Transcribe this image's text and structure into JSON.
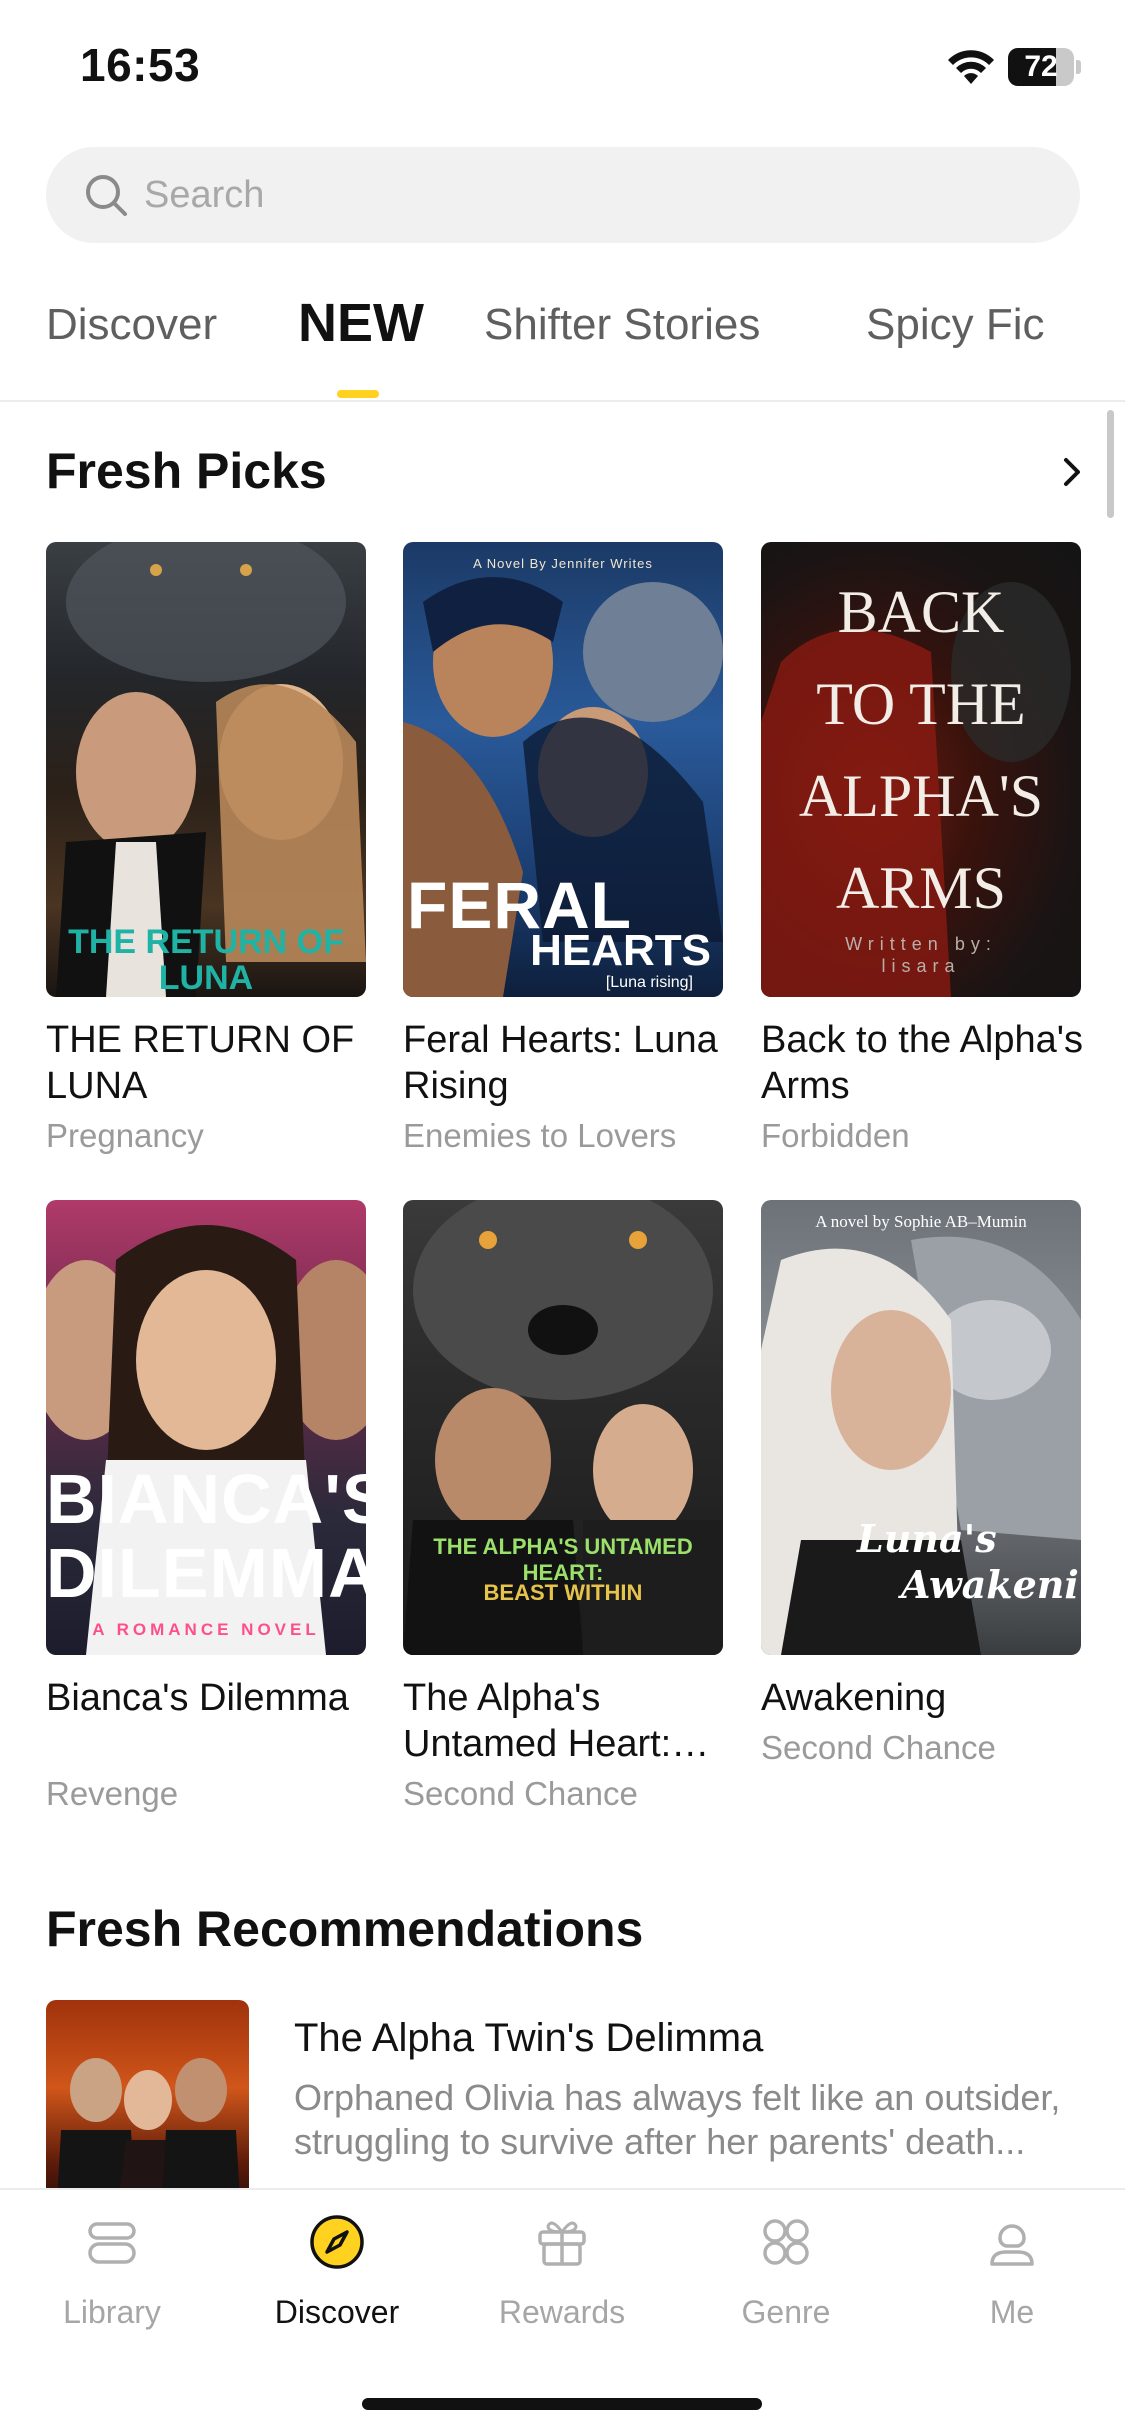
{
  "status": {
    "time": "16:53",
    "battery": "72",
    "battery_level": 0.72
  },
  "search": {
    "placeholder": "Search"
  },
  "tabs": [
    {
      "label": "Discover"
    },
    {
      "label": "NEW"
    },
    {
      "label": "Shifter Stories"
    },
    {
      "label": "Spicy Fic"
    }
  ],
  "fresh_picks": {
    "title": "Fresh Picks",
    "books": [
      {
        "title": "THE RETURN OF LUNA",
        "tag": "Pregnancy",
        "cover_text": "THE RETURN OF LUNA"
      },
      {
        "title": "Feral Hearts: Luna Rising",
        "tag": "Enemies to Lovers",
        "cover_byline": "A Novel By Jennifer Writes",
        "cover_text_1": "FERAL",
        "cover_text_2": "HEARTS",
        "cover_text_3": "[Luna rising]"
      },
      {
        "title": "Back to the Alpha's Arms",
        "tag": "Forbidden",
        "cover_lines": [
          "BACK",
          "TO THE",
          "ALPHA'S",
          "ARMS"
        ],
        "cover_byline_1": "Written by:",
        "cover_byline_2": "lisara"
      },
      {
        "title": "Bianca's Dilemma",
        "tag": "Revenge",
        "cover_text_1": "BIANCA'S",
        "cover_text_2": "DILEMMA",
        "cover_subtitle": "A ROMANCE NOVEL"
      },
      {
        "title": "The Alpha's Untamed Heart: Beast Within",
        "tag": "Second Chance",
        "cover_text_1": "THE ALPHA'S UNTAMED HEART:",
        "cover_text_2": "BEAST WITHIN"
      },
      {
        "title": "Awakening",
        "tag": "Second Chance",
        "cover_byline": "A novel by Sophie AB–Mumin",
        "cover_text_1": "Luna's",
        "cover_text_2": "Awakening"
      }
    ]
  },
  "fresh_recommendations": {
    "title": "Fresh Recommendations",
    "items": [
      {
        "title": "The Alpha Twin's Delimma",
        "description": "Orphaned Olivia has always felt like an outsider, struggling to survive after her parents' death..."
      }
    ]
  },
  "bottom_nav": [
    {
      "label": "Library",
      "icon": "library-icon"
    },
    {
      "label": "Discover",
      "icon": "compass-icon"
    },
    {
      "label": "Rewards",
      "icon": "gift-icon"
    },
    {
      "label": "Genre",
      "icon": "grid-icon"
    },
    {
      "label": "Me",
      "icon": "profile-icon"
    }
  ],
  "colors": {
    "accent": "#ffd21f",
    "text": "#111111",
    "muted": "#9a9a9a"
  }
}
